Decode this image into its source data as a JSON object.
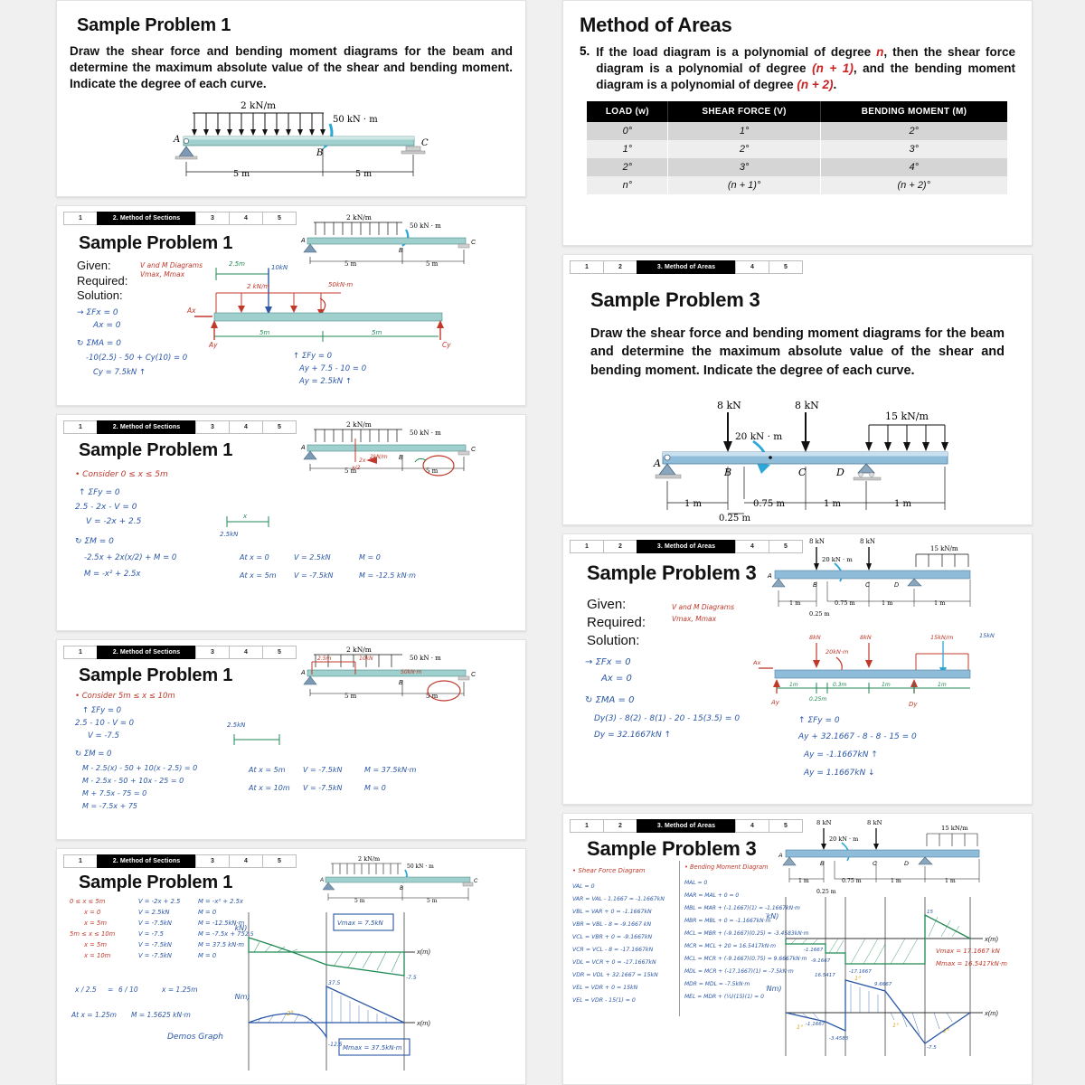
{
  "left_column": {
    "panels": [
      {
        "id": "p1",
        "title": "Sample Problem 1",
        "body": "Draw the shear force and bending moment diagrams for the beam and determine the maximum absolute value of the shear and bending moment. Indicate the degree of each curve.",
        "figure": {
          "udl_label": "2 kN/m",
          "moment_label": "50 kN · m",
          "node_a": "A",
          "node_b": "B",
          "node_c": "C",
          "dim_left": "5 m",
          "dim_right": "5 m"
        }
      },
      {
        "id": "p2",
        "pager": {
          "items": [
            "1",
            "2. Method of Sections",
            "3",
            "4",
            "5"
          ],
          "active_index": 1
        },
        "title": "Sample Problem 1",
        "labels": {
          "given": "Given:",
          "required": "Required:",
          "solution": "Solution:"
        },
        "hand_red": [
          "V and M Diagrams",
          "Vmax, Mmax"
        ],
        "hand_blue": [
          "→ ΣFx = 0",
          "Ax = 0",
          "↻ ΣMA = 0",
          "-10(2.5) - 50 + Cy(10) = 0",
          "Cy = 7.5kN ↑"
        ],
        "hand_blue2": [
          "↑ ΣFy = 0",
          "Ay + 7.5 - 10 = 0",
          "Ay = 2.5kN ↑"
        ],
        "fbd_labels": [
          "2.5m",
          "10kN",
          "2 kN/m",
          "50kN·m",
          "Ax",
          "Ay",
          "Cy",
          "5m",
          "5m"
        ]
      },
      {
        "id": "p3",
        "pager": {
          "items": [
            "1",
            "2. Method of Sections",
            "3",
            "4",
            "5"
          ],
          "active_index": 1
        },
        "title": "Sample Problem 1",
        "hand_red": [
          "• Consider  0 ≤ x ≤ 5m"
        ],
        "hand_blue": [
          "↑ ΣFy = 0",
          "2.5 - 2x - V = 0",
          "V = -2x + 2.5",
          "↻ ΣM = 0",
          "-2.5x + 2x(x/2) + M = 0",
          "M = -x² + 2.5x"
        ],
        "results": [
          {
            "at": "At  x = 0",
            "v": "V = 2.5kN",
            "m": "M = 0"
          },
          {
            "at": "At  x = 5m",
            "v": "V = -7.5kN",
            "m": "M = -12.5 kN·m"
          }
        ],
        "section_label": "2.5kN",
        "x_label": "x"
      },
      {
        "id": "p4",
        "pager": {
          "items": [
            "1",
            "2. Method of Sections",
            "3",
            "4",
            "5"
          ],
          "active_index": 1
        },
        "title": "Sample Problem 1",
        "hand_red": [
          "• Consider     5m ≤ x ≤ 10m"
        ],
        "hand_blue": [
          "↑ ΣFy = 0",
          "2.5 - 10 - V = 0",
          "V = -7.5",
          "↻ ΣM = 0",
          "M - 2.5(x) - 50 + 10(x - 2.5) = 0",
          "M - 2.5x - 50 + 10x - 25 = 0",
          "M + 7.5x - 75 = 0",
          "M = -7.5x + 75"
        ],
        "results": [
          {
            "at": "At  x = 5m",
            "v": "V = -7.5kN",
            "m": "M = 37.5kN·m"
          },
          {
            "at": "At  x = 10m",
            "v": "V = -7.5kN",
            "m": "M = 0"
          }
        ],
        "section_label": "2.5kN"
      },
      {
        "id": "p5",
        "pager": {
          "items": [
            "1",
            "2. Method of Sections",
            "3",
            "4",
            "5"
          ],
          "active_index": 1
        },
        "title": "Sample Problem 1",
        "table_rows": [
          {
            "range": "0 ≤ x ≤ 5m",
            "v": "V = -2x + 2.5",
            "m": "M = -x² + 2.5x"
          },
          {
            "range": "x = 0",
            "v": "V = 2.5kN",
            "m": "M = 0"
          },
          {
            "range": "x = 5m",
            "v": "V = -7.5kN",
            "m": "M = -12.5kN·m"
          },
          {
            "range": "5m ≤ x ≤ 10m",
            "v": "V = -7.5",
            "m": "M = -7.5x + 75"
          },
          {
            "range": "x = 5m",
            "v": "V = -7.5kN",
            "m": "M = 37.5 kN·m"
          },
          {
            "range": "x = 10m",
            "v": "V = -7.5kN",
            "m": "M = 0"
          }
        ],
        "ratio": {
          "lhs": "x / 2.5",
          "rhs": "6 / 10",
          "result": "x = 1.25m"
        },
        "at_note": {
          "at": "At x = 1.25m",
          "m": "M = 1.5625 kN·m"
        },
        "demos": "Demos Graph",
        "charts": {
          "v_axis_label": "V(kN)",
          "m_axis_label": "M(kNm)",
          "x_axis_label": "x(m)",
          "v_max_box": "Vmax = 7.5kN",
          "m_max_box": "Mmax = 37.5kN·m",
          "v_start": "2.5",
          "v_end": "-7.5",
          "m_peak": "37.5",
          "m_dip": "-12.5",
          "deg1": "1°",
          "deg2": "2°"
        },
        "figure": {
          "udl_label": "2 kN/m",
          "moment_label": "50 kN · m",
          "node_a": "A",
          "node_b": "B",
          "node_c": "C",
          "dim_left": "5 m",
          "dim_right": "5 m"
        }
      }
    ]
  },
  "right_column": {
    "panels": [
      {
        "id": "r1",
        "title": "Method of Areas",
        "item_number": "5.",
        "body_parts": [
          "If the load diagram is a polynomial of degree ",
          "n",
          ", then the shear force diagram is a polynomial of degree ",
          "(n + 1)",
          ", and the bending moment diagram is a polynomial of degree ",
          "(n + 2)",
          "."
        ],
        "table": {
          "headers": [
            "LOAD (w)",
            "SHEAR FORCE (V)",
            "BENDING MOMENT (M)"
          ],
          "rows": [
            [
              "0°",
              "1°",
              "2°"
            ],
            [
              "1°",
              "2°",
              "3°"
            ],
            [
              "2°",
              "3°",
              "4°"
            ],
            [
              "n°",
              "(n + 1)°",
              "(n + 2)°"
            ]
          ]
        }
      },
      {
        "id": "r2",
        "pager": {
          "items": [
            "1",
            "2",
            "3. Method of Areas",
            "4",
            "5"
          ],
          "active_index": 2
        },
        "title": "Sample Problem 3",
        "body": "Draw the shear force and bending moment diagrams for the beam and determine the maximum absolute value of the shear and bending moment. Indicate the degree of each curve.",
        "figure": {
          "load_p1": "8 kN",
          "load_p2": "8 kN",
          "moment_label": "20 kN · m",
          "udl_label": "15 kN/m",
          "node_a": "A",
          "node_b": "B",
          "node_c": "C",
          "node_d": "D",
          "dims": [
            "1 m",
            "0.75 m",
            "1 m",
            "1 m"
          ],
          "dim_small": "0.25 m"
        }
      },
      {
        "id": "r3",
        "pager": {
          "items": [
            "1",
            "2",
            "3. Method of Areas",
            "4",
            "5"
          ],
          "active_index": 2
        },
        "title": "Sample Problem 3",
        "labels": {
          "given": "Given:",
          "required": "Required:",
          "solution": "Solution:"
        },
        "hand_red": [
          "V and M Diagrams",
          "Vmax, Mmax"
        ],
        "hand_blue": [
          "→ ΣFx = 0",
          "Ax = 0",
          "↻ ΣMA = 0",
          "Dy(3) - 8(2) - 8(1) - 20 - 15(3.5) = 0",
          "Dy = 32.1667kN ↑"
        ],
        "hand_blue2": [
          "↑ ΣFy = 0",
          "Ay + 32.1667 - 8 - 8 - 15 = 0",
          "Ay = -1.1667kN ↑",
          "Ay = 1.1667kN ↓"
        ],
        "fbd_labels": [
          "8kN",
          "20kN·m",
          "8kN",
          "15kN/m",
          "15kN",
          "1m",
          "0.25m",
          "0.3m",
          "1m",
          "1m",
          "Ax",
          "Ay",
          "Dy"
        ],
        "figure": {
          "load_p1": "8 kN",
          "load_p2": "8 kN",
          "moment_label": "20 kN · m",
          "udl_label": "15 kN/m",
          "node_a": "A",
          "node_b": "B",
          "node_c": "C",
          "node_d": "D",
          "dims": [
            "1 m",
            "0.75 m",
            "1 m",
            "1 m"
          ],
          "dim_small": "0.25 m"
        }
      },
      {
        "id": "r4",
        "pager": {
          "items": [
            "1",
            "2",
            "3. Method of Areas",
            "4",
            "5"
          ],
          "active_index": 2
        },
        "title": "Sample Problem 3",
        "heading_shear": "• Shear Force Diagram",
        "heading_moment": "• Bending Moment Diagram",
        "shear_lines": [
          "VAL = 0",
          "VAR = VAL - 1.1667 = -1.1667kN",
          "VBL = VAR + 0 = -1.1667kN",
          "VBR = VBL - 8 = -9.1667 kN",
          "VCL = VBR + 0 = -9.1667kN",
          "VCR = VCL - 8 = -17.1667kN",
          "VDL = VCR + 0 = -17.1667kN",
          "VDR = VDL + 32.1667 = 15kN",
          "VEL = VDR + 0 = 15kN",
          "VEL = VDR - 15(1) = 0"
        ],
        "moment_lines": [
          "MAL = 0",
          "MAR = MAL + 0 = 0",
          "MBL = MAR + (-1.1667)(1) = -1.1667kN·m",
          "MBR = MBL + 0 = -1.1667kN·m",
          "MCL = MBR + (-9.1667)(0.25) = -3.4583kN·m",
          "MCR = MCL + 20 = 16.5417kN·m",
          "MCL = MCR + (-9.1667)(0.75) = 9.6667kN·m",
          "MDL = MCR + (-17.1667)(1) = -7.5kN·m",
          "MDR = MDL = -7.5kN·m",
          "MEL = MDR + (½)(15)(1) = 0"
        ],
        "answers": {
          "v_max": "Vmax = 17.1667 kN",
          "m_max": "Mmax = 16.5417kN·m"
        },
        "charts": {
          "v_axis_label": "V(kN)",
          "m_axis_label": "M(kNm)",
          "x_axis_label": "x(m)",
          "v_points": [
            "-1.1667",
            "-9.1667",
            "-17.1667",
            "15"
          ],
          "m_points": [
            "-1.1667",
            "-3.4583",
            "16.5417",
            "9.6667",
            "-7.5"
          ],
          "degrees": [
            "1°",
            "1°",
            "1°",
            "2°"
          ]
        },
        "figure": {
          "load_p1": "8 kN",
          "load_p2": "8 kN",
          "moment_label": "20 kN · m",
          "udl_label": "15 kN/m",
          "node_a": "A",
          "node_b": "B",
          "node_c": "C",
          "node_d": "D",
          "dims": [
            "1 m",
            "0.75 m",
            "1 m",
            "1 m"
          ],
          "dim_small": "0.25 m"
        }
      }
    ]
  },
  "colors": {
    "ink_blue": "#2b57a6",
    "ink_red": "#c0392b",
    "ink_green": "#1f8a54",
    "ink_yellow": "#d8a81a",
    "beam_fill": "#9fc6dc",
    "beam_fill_teal": "#a8cfcb",
    "accent_red": "#cc2222",
    "page_bg": "#f0f0f0"
  }
}
